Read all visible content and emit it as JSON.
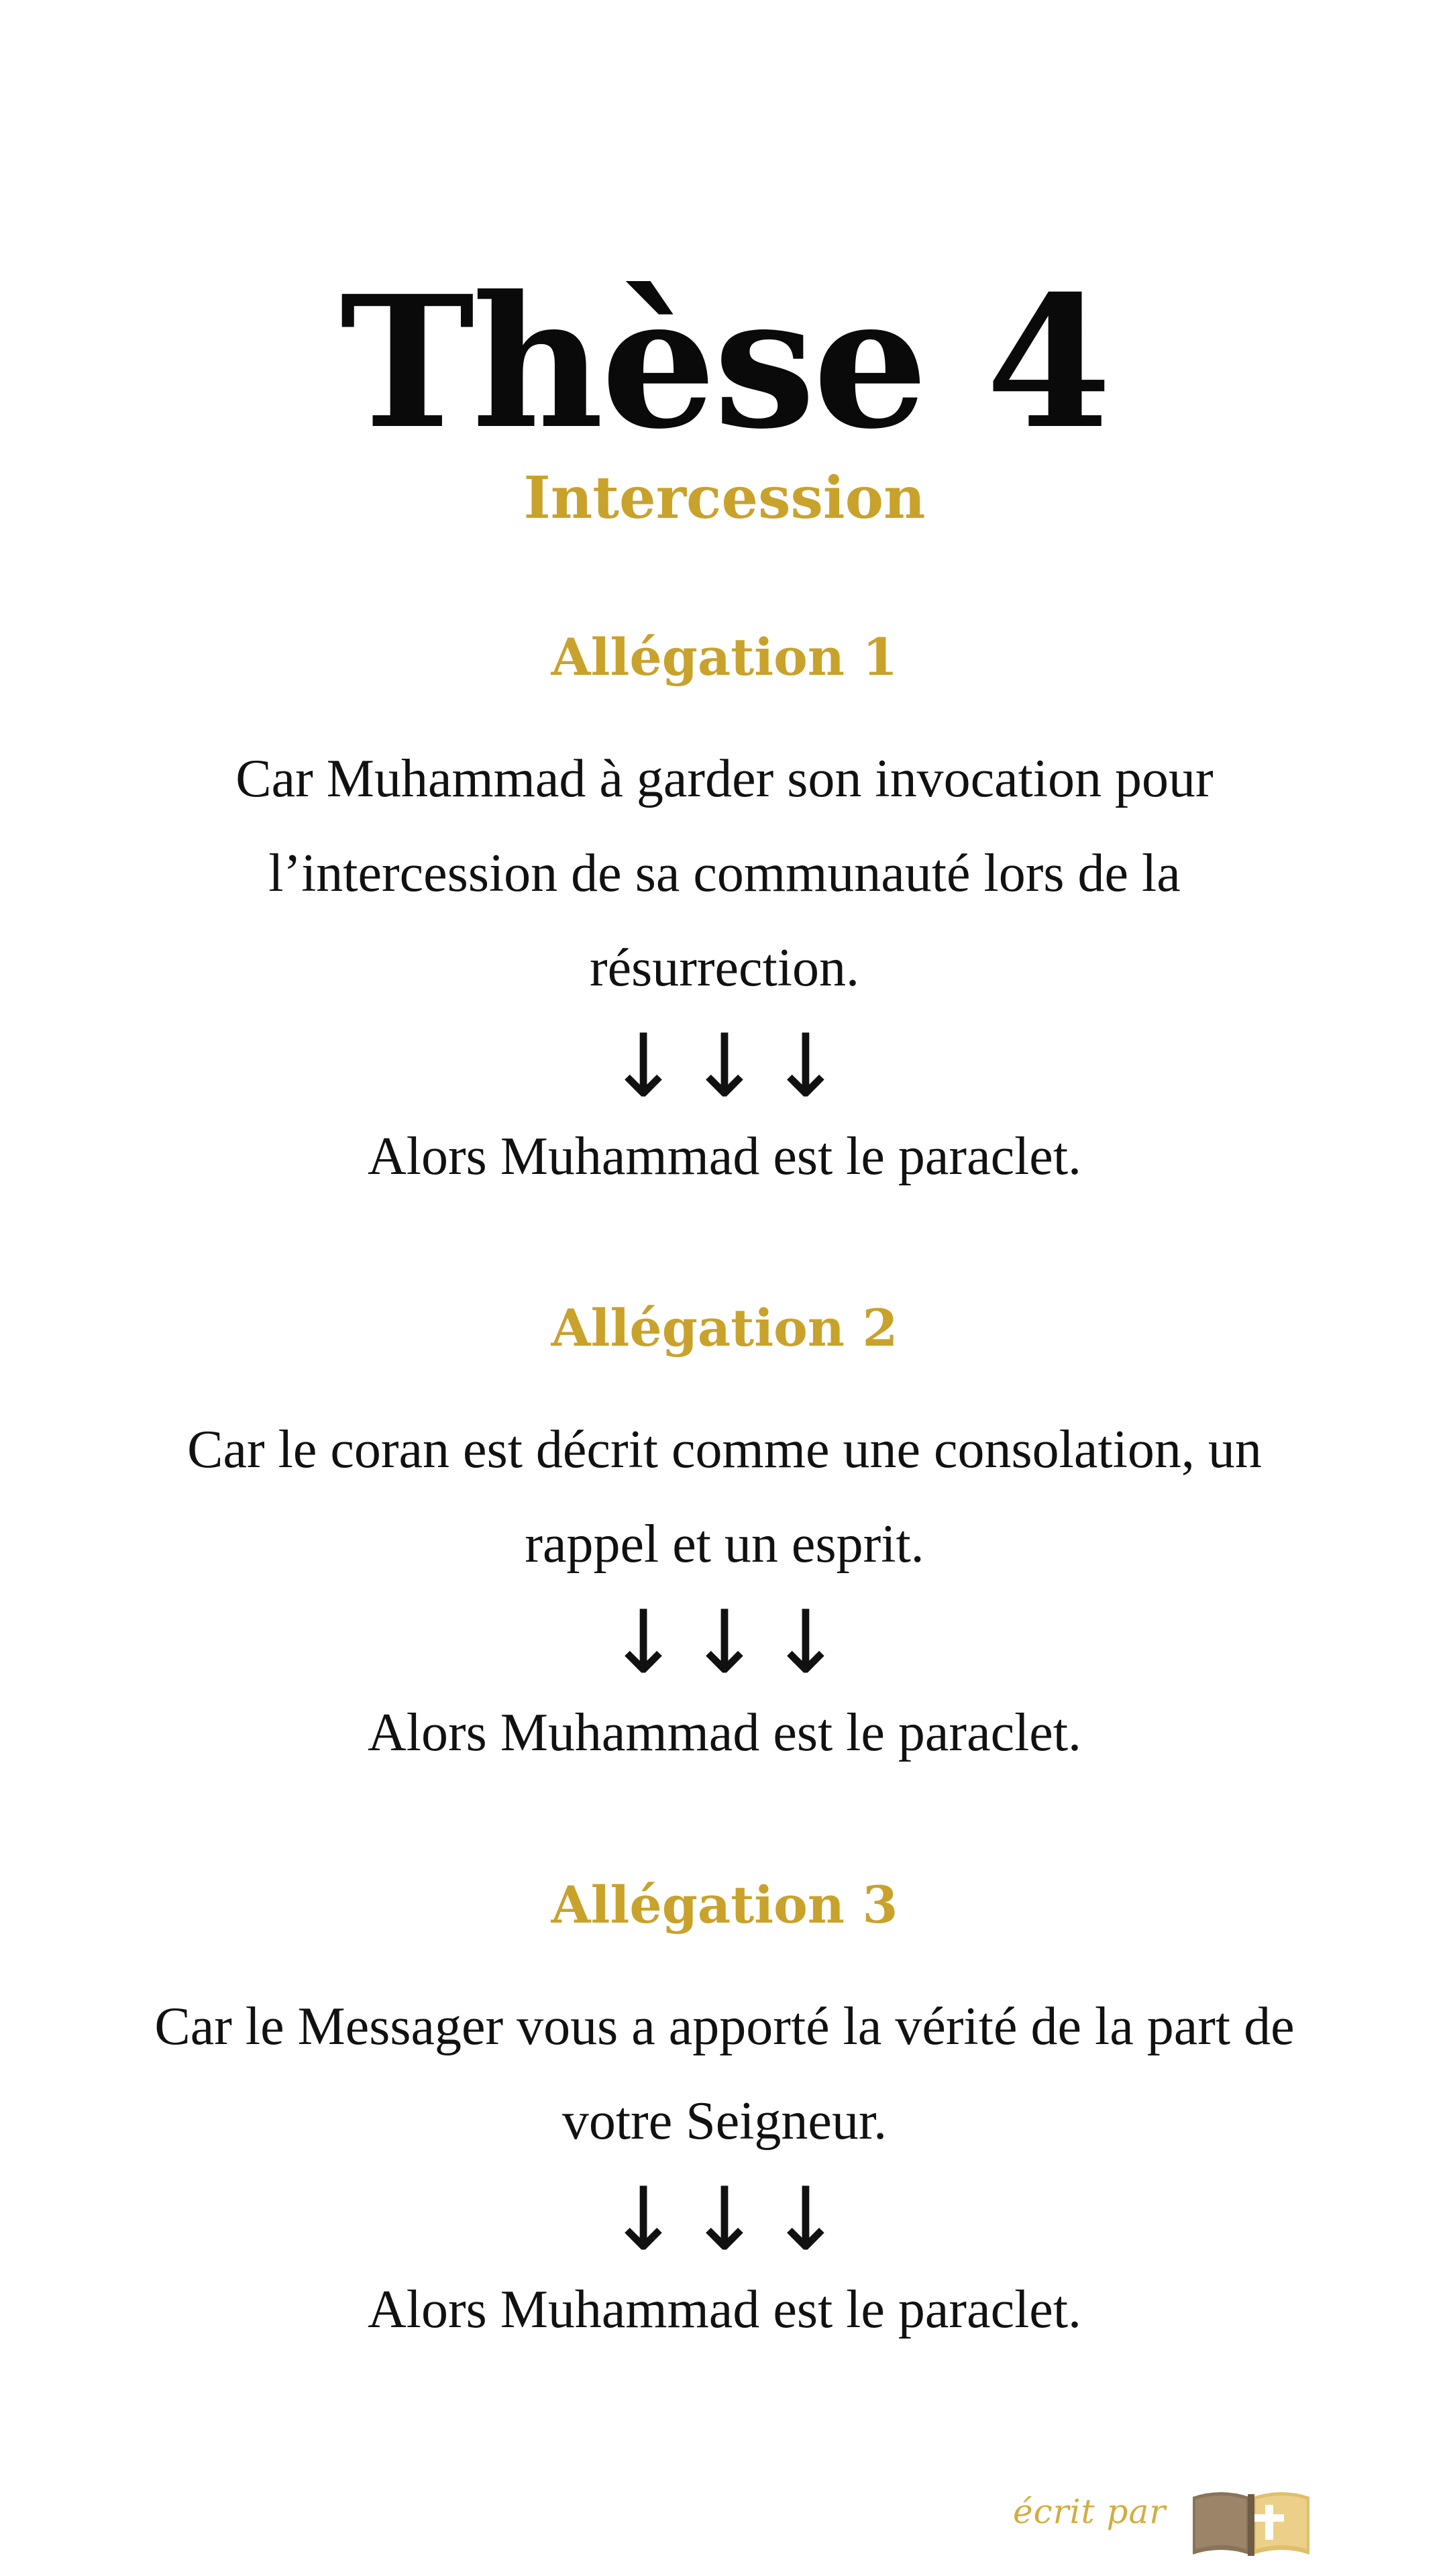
{
  "title": "Thèse 4",
  "subtitle": "Intercession",
  "sections": [
    {
      "heading": "Allégation 1",
      "claim": "Car Muhammad à garder son invocation pour l’intercession de sa communauté lors de la résurrection.",
      "arrows": "↓↓↓",
      "conclusion": "Alors Muhammad est le paraclet."
    },
    {
      "heading": "Allégation 2",
      "claim": "Car le coran est décrit comme une consolation, un rappel et un esprit.",
      "arrows": "↓↓↓",
      "conclusion": "Alors Muhammad est le paraclet."
    },
    {
      "heading": "Allégation 3",
      "claim": "Car le Messager vous a apporté la vérité de la part de votre Seigneur.",
      "arrows": "↓↓↓",
      "conclusion": "Alors Muhammad est le paraclet."
    }
  ],
  "footer": {
    "label": "écrit par",
    "logo_icon": "open-bible-cross-icon"
  },
  "colors": {
    "accent": "#c9a22c",
    "text": "#111111",
    "background": "#ffffff"
  }
}
